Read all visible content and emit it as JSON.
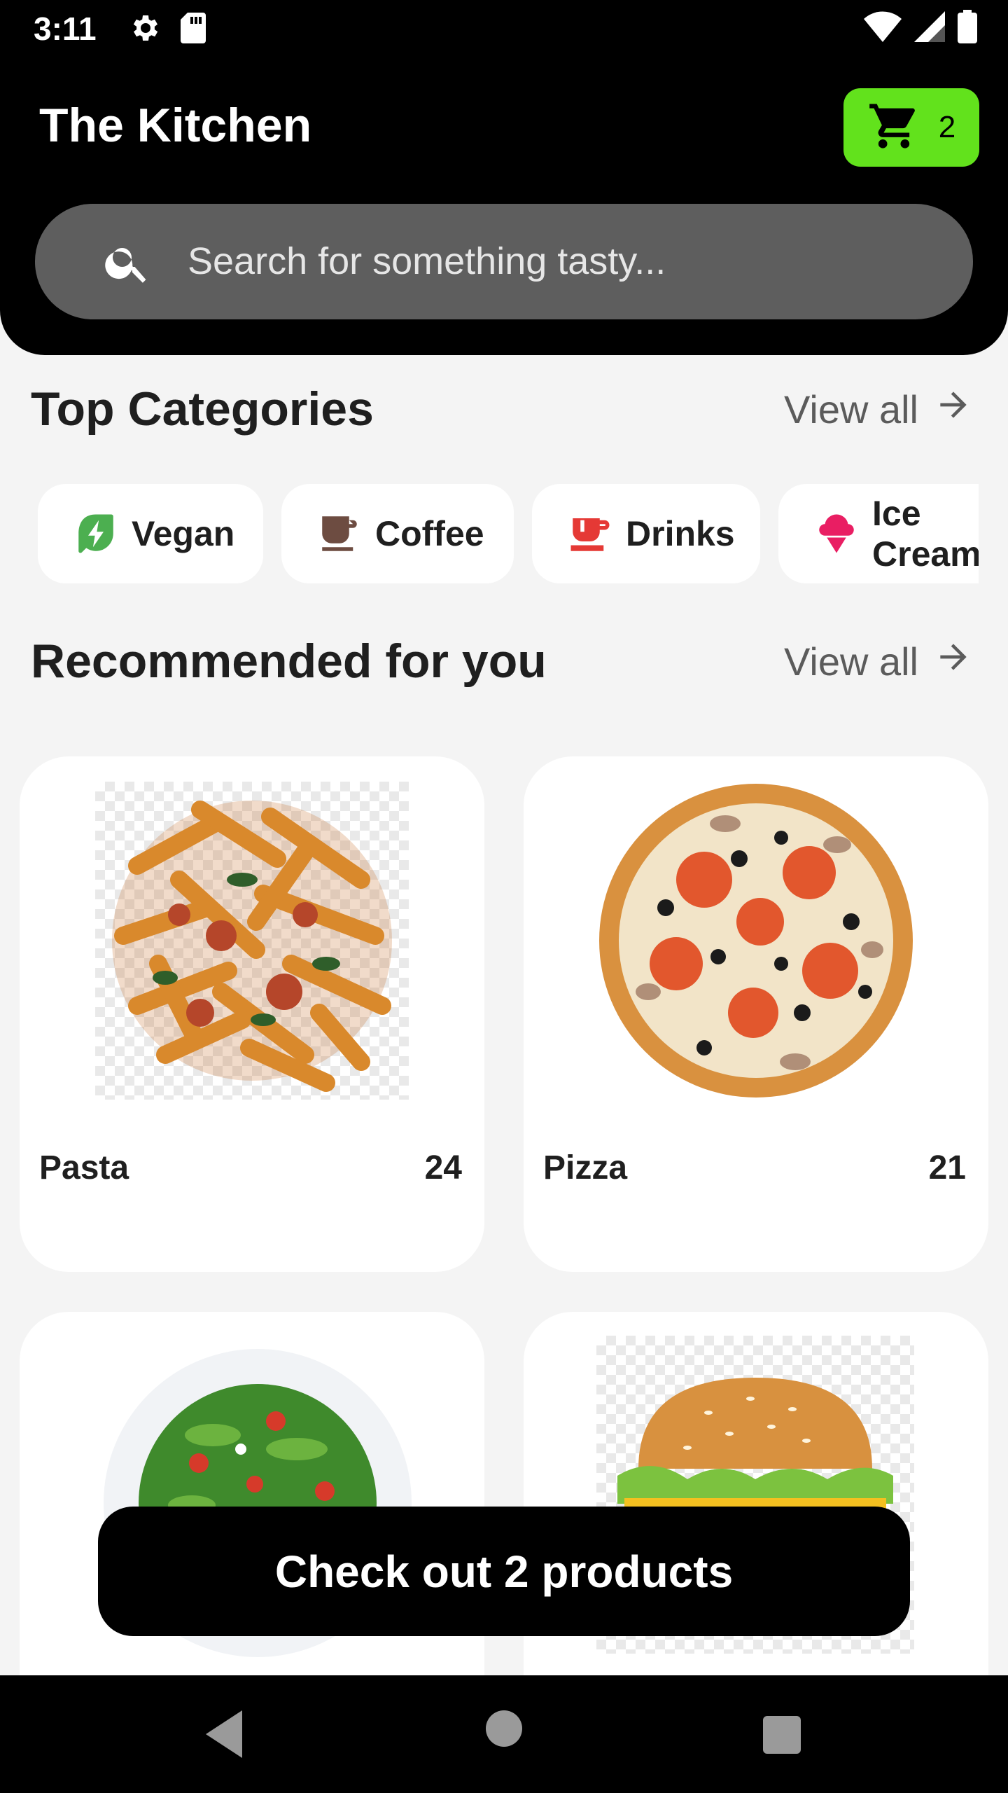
{
  "status_bar": {
    "time": "3:11"
  },
  "header": {
    "title": "The Kitchen",
    "cart_count": "2",
    "accent_color": "#62e21c"
  },
  "search": {
    "placeholder": "Search for something tasty..."
  },
  "top_categories": {
    "title": "Top Categories",
    "view_all": "View all",
    "items": [
      {
        "label": "Vegan",
        "icon": "vegan-leaf-icon",
        "color": "#4caf50"
      },
      {
        "label": "Coffee",
        "icon": "coffee-cup-icon",
        "color": "#6d4c41"
      },
      {
        "label": "Drinks",
        "icon": "drink-mug-icon",
        "color": "#e53935"
      },
      {
        "label": "Ice Cream",
        "icon": "ice-cream-icon",
        "color": "#e91e63"
      }
    ]
  },
  "recommended": {
    "title": "Recommended for you",
    "view_all": "View all",
    "items": [
      {
        "name": "Pasta",
        "price": "24",
        "image": "pasta-image"
      },
      {
        "name": "Pizza",
        "price": "21",
        "image": "pizza-image"
      },
      {
        "name": "",
        "price": "",
        "image": "salad-image"
      },
      {
        "name": "",
        "price": "",
        "image": "burger-image"
      }
    ]
  },
  "checkout": {
    "label": "Check out 2 products"
  }
}
